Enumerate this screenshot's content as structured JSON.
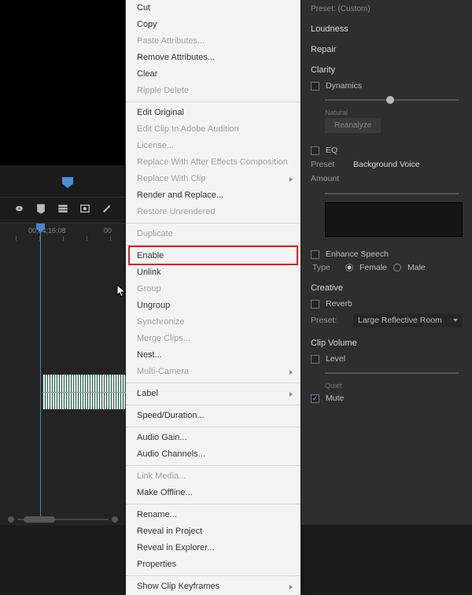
{
  "timeline": {
    "timecodes": [
      "00;04;16;08",
      "00"
    ]
  },
  "context_menu": {
    "highlighted_item_label": "Enable",
    "groups": [
      [
        {
          "label": "Cut",
          "enabled": true
        },
        {
          "label": "Copy",
          "enabled": true
        },
        {
          "label": "Paste Attributes...",
          "enabled": false
        },
        {
          "label": "Remove Attributes...",
          "enabled": true
        },
        {
          "label": "Clear",
          "enabled": true
        },
        {
          "label": "Ripple Delete",
          "enabled": false
        }
      ],
      [
        {
          "label": "Edit Original",
          "enabled": true
        },
        {
          "label": "Edit Clip In Adobe Audition",
          "enabled": false
        },
        {
          "label": "License...",
          "enabled": false
        },
        {
          "label": "Replace With After Effects Composition",
          "enabled": false
        },
        {
          "label": "Replace With Clip",
          "enabled": false,
          "submenu": true
        },
        {
          "label": "Render and Replace...",
          "enabled": true
        },
        {
          "label": "Restore Unrendered",
          "enabled": false
        }
      ],
      [
        {
          "label": "Duplicate",
          "enabled": false
        }
      ],
      [
        {
          "label": "Enable",
          "enabled": true
        },
        {
          "label": "Unlink",
          "enabled": true
        },
        {
          "label": "Group",
          "enabled": false
        },
        {
          "label": "Ungroup",
          "enabled": true
        },
        {
          "label": "Synchronize",
          "enabled": false
        },
        {
          "label": "Merge Clips...",
          "enabled": false
        },
        {
          "label": "Nest...",
          "enabled": true
        },
        {
          "label": "Multi-Camera",
          "enabled": false,
          "submenu": true
        }
      ],
      [
        {
          "label": "Label",
          "enabled": true,
          "submenu": true
        }
      ],
      [
        {
          "label": "Speed/Duration...",
          "enabled": true
        }
      ],
      [
        {
          "label": "Audio Gain...",
          "enabled": true
        },
        {
          "label": "Audio Channels...",
          "enabled": true
        }
      ],
      [
        {
          "label": "Link Media...",
          "enabled": false
        },
        {
          "label": "Make Offline...",
          "enabled": true
        }
      ],
      [
        {
          "label": "Rename...",
          "enabled": true
        },
        {
          "label": "Reveal in Project",
          "enabled": true
        },
        {
          "label": "Reveal in Explorer...",
          "enabled": true
        },
        {
          "label": "Properties",
          "enabled": true
        }
      ],
      [
        {
          "label": "Show Clip Keyframes",
          "enabled": true,
          "submenu": true
        }
      ]
    ]
  },
  "effects_panel": {
    "preset_label": "Preset:",
    "preset_value": "(Custom)",
    "loudness": {
      "title": "Loudness"
    },
    "repair": {
      "title": "Repair"
    },
    "clarity": {
      "title": "Clarity",
      "dynamics_label": "Dynamics",
      "natural_label": "Natural",
      "reanalyze_label": "Reanalyze",
      "eq_label": "EQ",
      "eq_preset_label": "Preset",
      "eq_preset_value": "Background Voice",
      "amount_label": "Amount",
      "enhance_label": "Enhance Speech",
      "type_label": "Type",
      "female_label": "Female",
      "male_label": "Male"
    },
    "creative": {
      "title": "Creative",
      "reverb_label": "Reverb",
      "preset_label": "Preset:",
      "preset_value": "Large Reflective Room"
    },
    "clip_volume": {
      "title": "Clip Volume",
      "level_label": "Level",
      "quiet_label": "Quiet",
      "mute_label": "Mute"
    }
  }
}
